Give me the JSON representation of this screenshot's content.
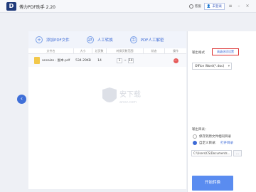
{
  "app": {
    "logo_text": "D",
    "title": "傅力PDF助手 2.20"
  },
  "titlebar": {
    "msg_label": "客服",
    "login_label": "未登录"
  },
  "toolbar": {
    "add_pdf": "添加PDF文件",
    "manual_convert": "人工转换",
    "pdf_manual": "PDF人工解密"
  },
  "table": {
    "headers": [
      "文件名",
      "大小",
      "总页数",
      "转换页数范围",
      "状态",
      "操作"
    ],
    "rows": [
      {
        "name": "ansaize - 副本.pdf",
        "size": "534.29KB",
        "pages": "14",
        "from": "1",
        "to": "14"
      }
    ]
  },
  "watermark": {
    "text": "安下载",
    "sub": "anxz.com"
  },
  "panel": {
    "output_mode_label": "输出格式",
    "settings_button": "高级选项设置",
    "format_value": "Office Word(*.doc)",
    "output_dir_label": "输出目录：",
    "opt_original": "保存到原文件相同目录",
    "opt_custom": "自定义目录：",
    "opt_custom_link": "打开目录",
    "path_value": "C:\\Users\\CS\\Documents...",
    "browse_label": "...",
    "start_button": "开始转换"
  },
  "colors": {
    "accent": "#3d6ad6",
    "start": "#5a8cf0",
    "highlight": "#d33"
  }
}
